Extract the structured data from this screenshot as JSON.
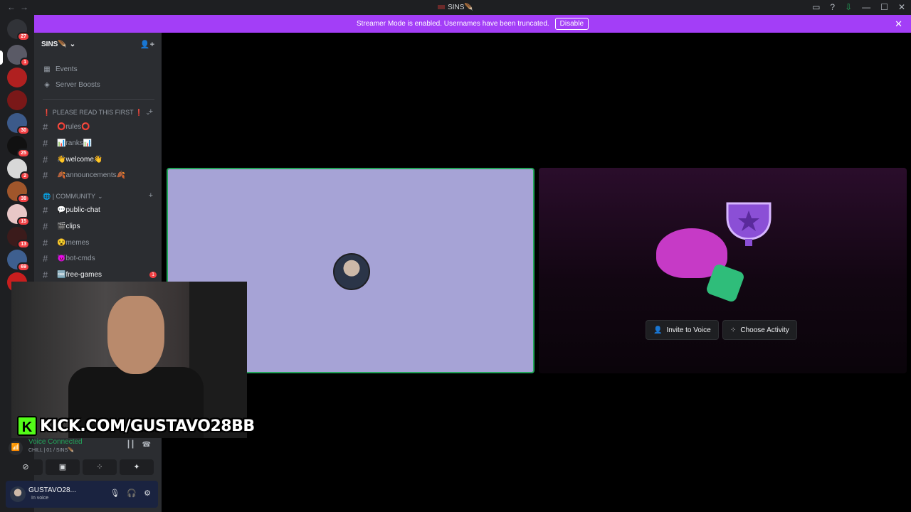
{
  "titlebar": {
    "title": "SINS🪶",
    "nav_back": "←",
    "nav_fwd": "→",
    "inbox_icon": "inbox-icon",
    "help_icon": "help-icon",
    "download_icon": "download-icon",
    "min": "—",
    "max": "☐",
    "close": "✕"
  },
  "banner": {
    "text": "Streamer Mode is enabled. Usernames have been truncated.",
    "button": "Disable",
    "close": "✕"
  },
  "guilds": [
    {
      "badge": "27"
    },
    {
      "badge": "1"
    },
    {
      "badge": ""
    },
    {
      "badge": ""
    },
    {
      "badge": "30"
    },
    {
      "badge": "25"
    },
    {
      "badge": "2"
    },
    {
      "badge": "38"
    },
    {
      "badge": "15"
    },
    {
      "badge": "13"
    },
    {
      "badge": "69"
    },
    {
      "badge": ""
    }
  ],
  "server": {
    "name": "SINS🪶",
    "chevron": "⌄",
    "add_user_icon": "add-user-icon"
  },
  "menu": {
    "events": "Events",
    "boosts": "Server Boosts"
  },
  "categories": [
    {
      "name": "❗ PLEASE READ THIS FIRST ❗",
      "channels": [
        {
          "name": "⭕rules⭕",
          "bright": false
        },
        {
          "name": "📊ranks📊",
          "bright": false
        },
        {
          "name": "👋welcome👋",
          "bright": true
        },
        {
          "name": "🍂announcements🍂",
          "bright": false
        }
      ]
    },
    {
      "name": "🌐 | COMMUNITY",
      "channels": [
        {
          "name": "💬public-chat",
          "bright": true
        },
        {
          "name": "🎬clips",
          "bright": true
        },
        {
          "name": "😵memes",
          "bright": false
        },
        {
          "name": "😈bot-cmds",
          "bright": false
        },
        {
          "name": "🆓free-games",
          "bright": true,
          "mention": "1"
        }
      ]
    }
  ],
  "activity": {
    "invite": "Invite to Voice",
    "choose": "Choose Activity"
  },
  "overlay": {
    "kick": "KICK.COM/GUSTAVO28BB",
    "k": "K"
  },
  "voice": {
    "status": "Voice Connected",
    "channel": "CHILL | 01 / SINS🪶"
  },
  "user": {
    "name": "GUSTAVO28...",
    "status": "In voice"
  },
  "colors": {
    "blurple": "#a33ef7",
    "green": "#23a55a",
    "tile": "#a6a3d6"
  }
}
